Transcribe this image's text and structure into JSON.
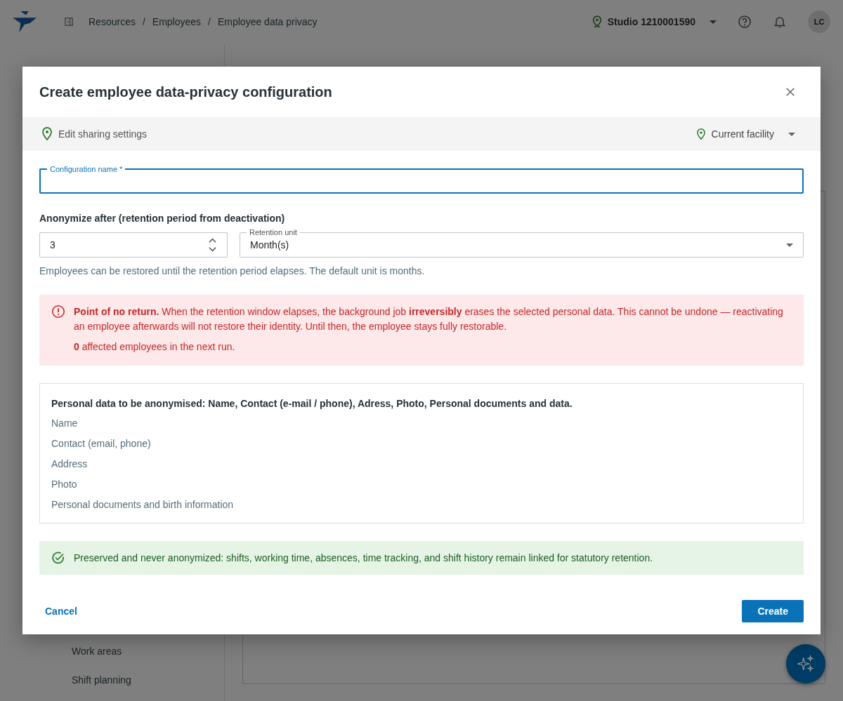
{
  "topbar": {
    "breadcrumbs": [
      {
        "label": "Resources"
      },
      {
        "separator": "/",
        "label": "Employees"
      },
      {
        "separator": "/",
        "label": "Employee data privacy"
      }
    ],
    "facility": "Studio 1210001590",
    "avatar": "LC"
  },
  "sidebar": {
    "items": [
      "Work areas",
      "Shift planning"
    ]
  },
  "dialog": {
    "title": "Create employee data-privacy configuration",
    "sharing": {
      "label": "Edit sharing settings",
      "scope": "Current facility"
    },
    "name_field": {
      "label": "Configuration name *"
    },
    "retention": {
      "label": "Anonymize after (retention period from deactivation)",
      "amount": "3",
      "unit_label": "Retention unit",
      "unit": "Month(s)",
      "helper": "Employees can be restored until the retention period elapses. The default unit is months."
    },
    "warning": {
      "text": "**Point of no return.** When the retention window elapses, the background job **irreversibly** erases the selected personal data. This cannot be undone — reactivating an employee afterwards will not restore their identity. Until then, the employee stays fully restorable.",
      "count": "**0** affected employees in the next run."
    },
    "data_box": {
      "heading": "Personal data to be anonymised: Name, Contact (e-mail / phone), Adress, Photo, Personal documents and data.",
      "items": [
        "Name",
        "Contact (email, phone)",
        "Address",
        "Photo",
        "Personal documents and birth information"
      ]
    },
    "preserved": "Preserved and never anonymized: shifts, working time, absences, time tracking, and shift history remain linked for statutory retention.",
    "buttons": {
      "cancel": "Cancel",
      "create": "Create"
    }
  }
}
